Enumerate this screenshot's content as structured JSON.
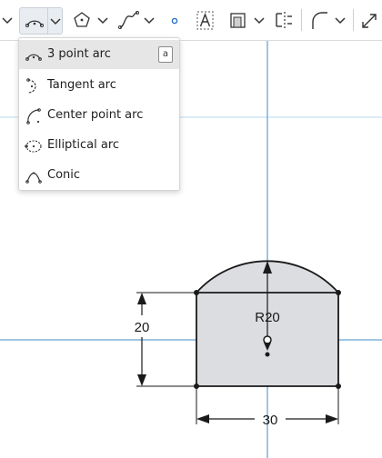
{
  "toolbar": {
    "items": [
      {
        "icon": "chevron-down-icon"
      },
      {
        "icon": "three-point-arc-icon",
        "selected": true
      },
      {
        "icon": "polygon-icon"
      },
      {
        "icon": "spline-icon"
      },
      {
        "icon": "point-icon"
      },
      {
        "icon": "sketch-text-icon"
      },
      {
        "icon": "use-entity-icon"
      },
      {
        "icon": "mirror-icon"
      },
      {
        "icon": "fillet-icon"
      },
      {
        "icon": "transform-icon"
      }
    ]
  },
  "arc_menu": {
    "items": [
      {
        "label": "3 point arc",
        "icon": "three-point-arc-icon",
        "shortcut": "a",
        "active": true
      },
      {
        "label": "Tangent arc",
        "icon": "tangent-arc-icon"
      },
      {
        "label": "Center point arc",
        "icon": "center-point-arc-icon"
      },
      {
        "label": "Elliptical arc",
        "icon": "elliptical-arc-icon"
      },
      {
        "label": "Conic",
        "icon": "conic-icon"
      }
    ]
  },
  "sketch": {
    "dimensions": {
      "height": "20",
      "width": "30",
      "radius": "R20"
    }
  },
  "colors": {
    "axis": "#7fb2d9",
    "axis_light": "#b8d8f0",
    "sketch_fill": "#dcdde1",
    "sketch_line": "#1a1a1a",
    "toolbar_selected": "#e9edf2"
  }
}
